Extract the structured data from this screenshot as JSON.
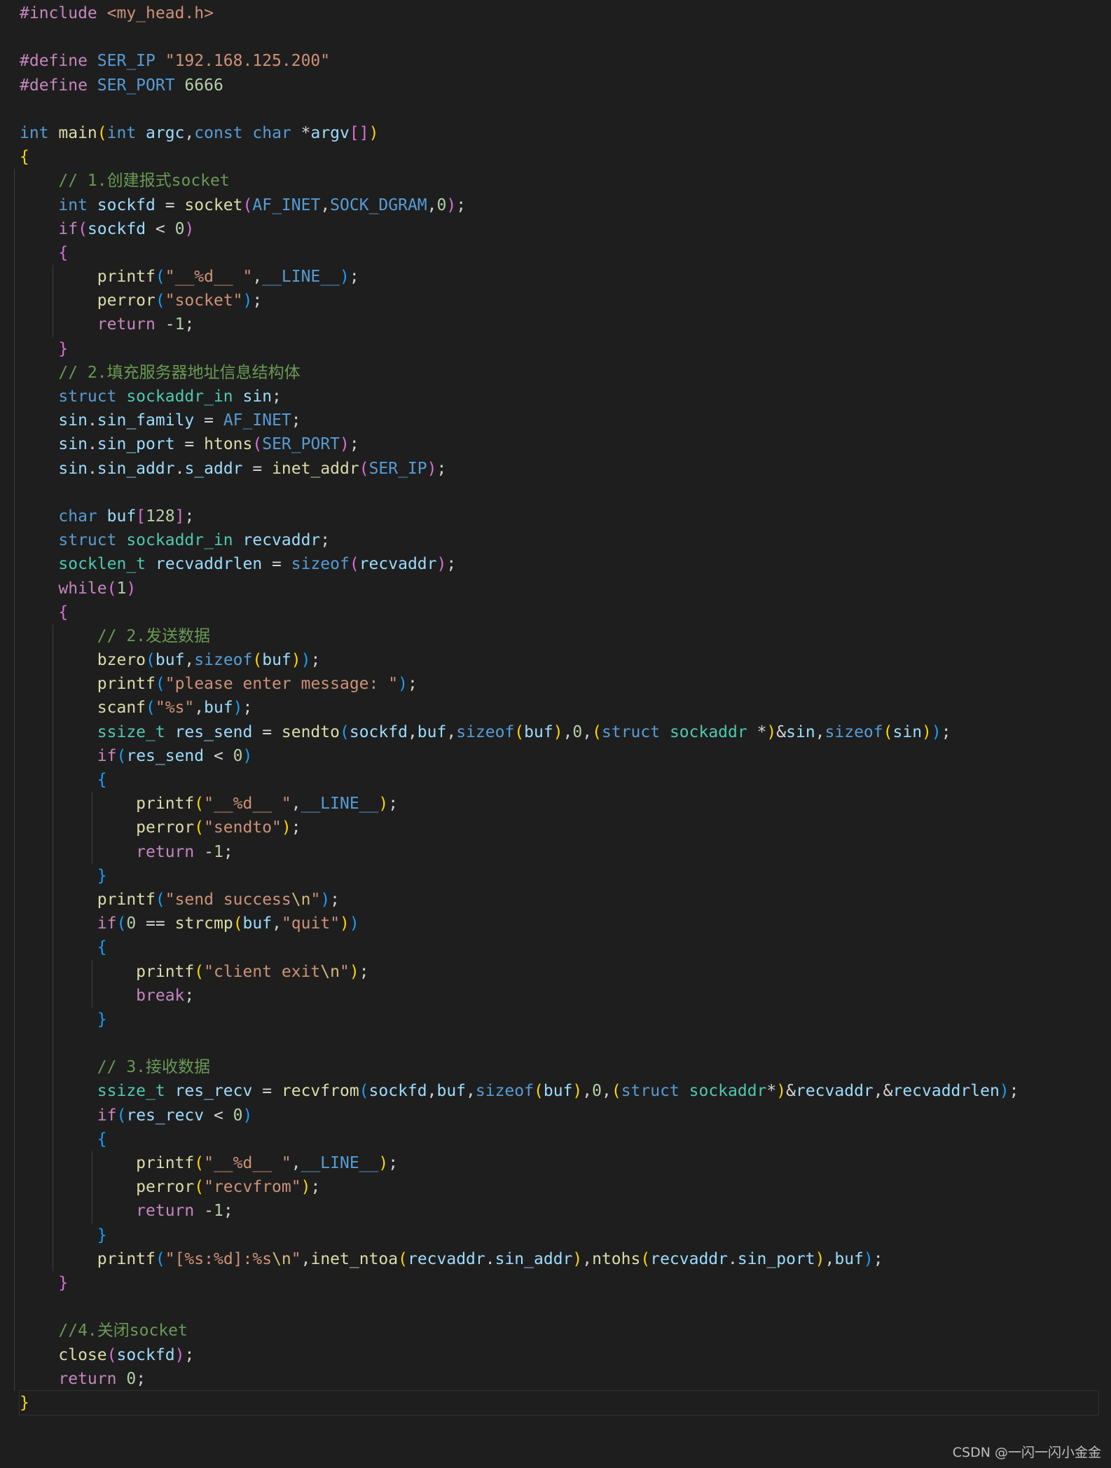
{
  "editor": {
    "theme_colors": {
      "background": "#1e1e1e",
      "keyword": "#569cd6",
      "control": "#c586c0",
      "function": "#dcdcaa",
      "variable": "#9cdcfe",
      "type": "#4ec9b0",
      "string": "#ce9178",
      "number": "#b5cea8",
      "comment": "#6a9955",
      "bracket_1": "#ffd700",
      "bracket_2": "#da70d6",
      "bracket_3": "#179fff"
    },
    "current_line": 58,
    "lines": [
      [
        [
          "pre",
          "#include "
        ],
        [
          "inc",
          "<my_head.h>"
        ]
      ],
      [],
      [
        [
          "pre",
          "#define "
        ],
        [
          "mac",
          "SER_IP "
        ],
        [
          "s",
          "\"192.168.125.200\""
        ]
      ],
      [
        [
          "pre",
          "#define "
        ],
        [
          "mac",
          "SER_PORT "
        ],
        [
          "n",
          "6666"
        ]
      ],
      [],
      [
        [
          "k",
          "int "
        ],
        [
          "f",
          "main"
        ],
        [
          "b1",
          "("
        ],
        [
          "k",
          "int "
        ],
        [
          "v",
          "argc"
        ],
        [
          "p",
          ","
        ],
        [
          "k",
          "const "
        ],
        [
          "k",
          "char "
        ],
        [
          "p",
          "*"
        ],
        [
          "v",
          "argv"
        ],
        [
          "b2",
          "[]"
        ],
        [
          "b1",
          ")"
        ]
      ],
      [
        [
          "b1",
          "{"
        ]
      ],
      [
        [
          "m",
          "    // 1.创建报式socket"
        ]
      ],
      [
        [
          "k",
          "    int "
        ],
        [
          "v",
          "sockfd"
        ],
        [
          "p",
          " = "
        ],
        [
          "f",
          "socket"
        ],
        [
          "b2",
          "("
        ],
        [
          "mac",
          "AF_INET"
        ],
        [
          "p",
          ","
        ],
        [
          "mac",
          "SOCK_DGRAM"
        ],
        [
          "p",
          ","
        ],
        [
          "n",
          "0"
        ],
        [
          "b2",
          ")"
        ],
        [
          "p",
          ";"
        ]
      ],
      [
        [
          "c",
          "    if"
        ],
        [
          "b2",
          "("
        ],
        [
          "v",
          "sockfd"
        ],
        [
          "p",
          " < "
        ],
        [
          "n",
          "0"
        ],
        [
          "b2",
          ")"
        ]
      ],
      [
        [
          "b2",
          "    {"
        ]
      ],
      [
        [
          "f",
          "        printf"
        ],
        [
          "b3",
          "("
        ],
        [
          "s",
          "\"__%d__ \""
        ],
        [
          "p",
          ","
        ],
        [
          "mac",
          "__LINE__"
        ],
        [
          "b3",
          ")"
        ],
        [
          "p",
          ";"
        ]
      ],
      [
        [
          "f",
          "        perror"
        ],
        [
          "b3",
          "("
        ],
        [
          "s",
          "\"socket\""
        ],
        [
          "b3",
          ")"
        ],
        [
          "p",
          ";"
        ]
      ],
      [
        [
          "c",
          "        return "
        ],
        [
          "p",
          "-"
        ],
        [
          "n",
          "1"
        ],
        [
          "p",
          ";"
        ]
      ],
      [
        [
          "b2",
          "    }"
        ]
      ],
      [
        [
          "m",
          "    // 2.填充服务器地址信息结构体"
        ]
      ],
      [
        [
          "k",
          "    struct "
        ],
        [
          "t",
          "sockaddr_in "
        ],
        [
          "v",
          "sin"
        ],
        [
          "p",
          ";"
        ]
      ],
      [
        [
          "v",
          "    sin"
        ],
        [
          "p",
          "."
        ],
        [
          "v",
          "sin_family"
        ],
        [
          "p",
          " = "
        ],
        [
          "mac",
          "AF_INET"
        ],
        [
          "p",
          ";"
        ]
      ],
      [
        [
          "v",
          "    sin"
        ],
        [
          "p",
          "."
        ],
        [
          "v",
          "sin_port"
        ],
        [
          "p",
          " = "
        ],
        [
          "f",
          "htons"
        ],
        [
          "b2",
          "("
        ],
        [
          "mac",
          "SER_PORT"
        ],
        [
          "b2",
          ")"
        ],
        [
          "p",
          ";"
        ]
      ],
      [
        [
          "v",
          "    sin"
        ],
        [
          "p",
          "."
        ],
        [
          "v",
          "sin_addr"
        ],
        [
          "p",
          "."
        ],
        [
          "v",
          "s_addr"
        ],
        [
          "p",
          " = "
        ],
        [
          "f",
          "inet_addr"
        ],
        [
          "b2",
          "("
        ],
        [
          "mac",
          "SER_IP"
        ],
        [
          "b2",
          ")"
        ],
        [
          "p",
          ";"
        ]
      ],
      [],
      [
        [
          "k",
          "    char "
        ],
        [
          "v",
          "buf"
        ],
        [
          "b2",
          "["
        ],
        [
          "n",
          "128"
        ],
        [
          "b2",
          "]"
        ],
        [
          "p",
          ";"
        ]
      ],
      [
        [
          "k",
          "    struct "
        ],
        [
          "t",
          "sockaddr_in "
        ],
        [
          "v",
          "recvaddr"
        ],
        [
          "p",
          ";"
        ]
      ],
      [
        [
          "t",
          "    socklen_t "
        ],
        [
          "v",
          "recvaddrlen"
        ],
        [
          "p",
          " = "
        ],
        [
          "k",
          "sizeof"
        ],
        [
          "b2",
          "("
        ],
        [
          "v",
          "recvaddr"
        ],
        [
          "b2",
          ")"
        ],
        [
          "p",
          ";"
        ]
      ],
      [
        [
          "c",
          "    while"
        ],
        [
          "b2",
          "("
        ],
        [
          "n",
          "1"
        ],
        [
          "b2",
          ")"
        ]
      ],
      [
        [
          "b2",
          "    {"
        ]
      ],
      [
        [
          "m",
          "        // 2.发送数据"
        ]
      ],
      [
        [
          "f",
          "        bzero"
        ],
        [
          "b3",
          "("
        ],
        [
          "v",
          "buf"
        ],
        [
          "p",
          ","
        ],
        [
          "k",
          "sizeof"
        ],
        [
          "b1",
          "("
        ],
        [
          "v",
          "buf"
        ],
        [
          "b1",
          ")"
        ],
        [
          "b3",
          ")"
        ],
        [
          "p",
          ";"
        ]
      ],
      [
        [
          "f",
          "        printf"
        ],
        [
          "b3",
          "("
        ],
        [
          "s",
          "\"please enter message: \""
        ],
        [
          "b3",
          ")"
        ],
        [
          "p",
          ";"
        ]
      ],
      [
        [
          "f",
          "        scanf"
        ],
        [
          "b3",
          "("
        ],
        [
          "s",
          "\"%s\""
        ],
        [
          "p",
          ","
        ],
        [
          "v",
          "buf"
        ],
        [
          "b3",
          ")"
        ],
        [
          "p",
          ";"
        ]
      ],
      [
        [
          "t",
          "        ssize_t "
        ],
        [
          "v",
          "res_send"
        ],
        [
          "p",
          " = "
        ],
        [
          "f",
          "sendto"
        ],
        [
          "b3",
          "("
        ],
        [
          "v",
          "sockfd"
        ],
        [
          "p",
          ","
        ],
        [
          "v",
          "buf"
        ],
        [
          "p",
          ","
        ],
        [
          "k",
          "sizeof"
        ],
        [
          "b1",
          "("
        ],
        [
          "v",
          "buf"
        ],
        [
          "b1",
          ")"
        ],
        [
          "p",
          ","
        ],
        [
          "n",
          "0"
        ],
        [
          "p",
          ","
        ],
        [
          "b1",
          "("
        ],
        [
          "k",
          "struct "
        ],
        [
          "t",
          "sockaddr "
        ],
        [
          "p",
          "*"
        ],
        [
          "b1",
          ")"
        ],
        [
          "p",
          "&"
        ],
        [
          "v",
          "sin"
        ],
        [
          "p",
          ","
        ],
        [
          "k",
          "sizeof"
        ],
        [
          "b1",
          "("
        ],
        [
          "v",
          "sin"
        ],
        [
          "b1",
          ")"
        ],
        [
          "b3",
          ")"
        ],
        [
          "p",
          ";"
        ]
      ],
      [
        [
          "c",
          "        if"
        ],
        [
          "b3",
          "("
        ],
        [
          "v",
          "res_send"
        ],
        [
          "p",
          " < "
        ],
        [
          "n",
          "0"
        ],
        [
          "b3",
          ")"
        ]
      ],
      [
        [
          "b3",
          "        {"
        ]
      ],
      [
        [
          "f",
          "            printf"
        ],
        [
          "b1",
          "("
        ],
        [
          "s",
          "\"__%d__ \""
        ],
        [
          "p",
          ","
        ],
        [
          "mac",
          "__LINE__"
        ],
        [
          "b1",
          ")"
        ],
        [
          "p",
          ";"
        ]
      ],
      [
        [
          "f",
          "            perror"
        ],
        [
          "b1",
          "("
        ],
        [
          "s",
          "\"sendto\""
        ],
        [
          "b1",
          ")"
        ],
        [
          "p",
          ";"
        ]
      ],
      [
        [
          "c",
          "            return "
        ],
        [
          "p",
          "-"
        ],
        [
          "n",
          "1"
        ],
        [
          "p",
          ";"
        ]
      ],
      [
        [
          "b3",
          "        }"
        ]
      ],
      [
        [
          "f",
          "        printf"
        ],
        [
          "b3",
          "("
        ],
        [
          "s",
          "\"send success"
        ],
        [
          "e",
          "\\n"
        ],
        [
          "s",
          "\""
        ],
        [
          "b3",
          ")"
        ],
        [
          "p",
          ";"
        ]
      ],
      [
        [
          "c",
          "        if"
        ],
        [
          "b3",
          "("
        ],
        [
          "n",
          "0"
        ],
        [
          "p",
          " == "
        ],
        [
          "f",
          "strcmp"
        ],
        [
          "b1",
          "("
        ],
        [
          "v",
          "buf"
        ],
        [
          "p",
          ","
        ],
        [
          "s",
          "\"quit\""
        ],
        [
          "b1",
          ")"
        ],
        [
          "b3",
          ")"
        ]
      ],
      [
        [
          "b3",
          "        {"
        ]
      ],
      [
        [
          "f",
          "            printf"
        ],
        [
          "b1",
          "("
        ],
        [
          "s",
          "\"client exit"
        ],
        [
          "e",
          "\\n"
        ],
        [
          "s",
          "\""
        ],
        [
          "b1",
          ")"
        ],
        [
          "p",
          ";"
        ]
      ],
      [
        [
          "c",
          "            break"
        ],
        [
          "p",
          ";"
        ]
      ],
      [
        [
          "b3",
          "        }"
        ]
      ],
      [],
      [
        [
          "m",
          "        // 3.接收数据"
        ]
      ],
      [
        [
          "t",
          "        ssize_t "
        ],
        [
          "v",
          "res_recv"
        ],
        [
          "p",
          " = "
        ],
        [
          "f",
          "recvfrom"
        ],
        [
          "b3",
          "("
        ],
        [
          "v",
          "sockfd"
        ],
        [
          "p",
          ","
        ],
        [
          "v",
          "buf"
        ],
        [
          "p",
          ","
        ],
        [
          "k",
          "sizeof"
        ],
        [
          "b1",
          "("
        ],
        [
          "v",
          "buf"
        ],
        [
          "b1",
          ")"
        ],
        [
          "p",
          ","
        ],
        [
          "n",
          "0"
        ],
        [
          "p",
          ","
        ],
        [
          "b1",
          "("
        ],
        [
          "k",
          "struct "
        ],
        [
          "t",
          "sockaddr"
        ],
        [
          "p",
          "*"
        ],
        [
          "b1",
          ")"
        ],
        [
          "p",
          "&"
        ],
        [
          "v",
          "recvaddr"
        ],
        [
          "p",
          ",&"
        ],
        [
          "v",
          "recvaddrlen"
        ],
        [
          "b3",
          ")"
        ],
        [
          "p",
          ";"
        ]
      ],
      [
        [
          "c",
          "        if"
        ],
        [
          "b3",
          "("
        ],
        [
          "v",
          "res_recv"
        ],
        [
          "p",
          " < "
        ],
        [
          "n",
          "0"
        ],
        [
          "b3",
          ")"
        ]
      ],
      [
        [
          "b3",
          "        {"
        ]
      ],
      [
        [
          "f",
          "            printf"
        ],
        [
          "b1",
          "("
        ],
        [
          "s",
          "\"__%d__ \""
        ],
        [
          "p",
          ","
        ],
        [
          "mac",
          "__LINE__"
        ],
        [
          "b1",
          ")"
        ],
        [
          "p",
          ";"
        ]
      ],
      [
        [
          "f",
          "            perror"
        ],
        [
          "b1",
          "("
        ],
        [
          "s",
          "\"recvfrom\""
        ],
        [
          "b1",
          ")"
        ],
        [
          "p",
          ";"
        ]
      ],
      [
        [
          "c",
          "            return "
        ],
        [
          "p",
          "-"
        ],
        [
          "n",
          "1"
        ],
        [
          "p",
          ";"
        ]
      ],
      [
        [
          "b3",
          "        }"
        ]
      ],
      [
        [
          "f",
          "        printf"
        ],
        [
          "b3",
          "("
        ],
        [
          "s",
          "\"[%s:%d]:%s"
        ],
        [
          "e",
          "\\n"
        ],
        [
          "s",
          "\""
        ],
        [
          "p",
          ","
        ],
        [
          "f",
          "inet_ntoa"
        ],
        [
          "b1",
          "("
        ],
        [
          "v",
          "recvaddr"
        ],
        [
          "p",
          "."
        ],
        [
          "v",
          "sin_addr"
        ],
        [
          "b1",
          ")"
        ],
        [
          "p",
          ","
        ],
        [
          "f",
          "ntohs"
        ],
        [
          "b1",
          "("
        ],
        [
          "v",
          "recvaddr"
        ],
        [
          "p",
          "."
        ],
        [
          "v",
          "sin_port"
        ],
        [
          "b1",
          ")"
        ],
        [
          "p",
          ","
        ],
        [
          "v",
          "buf"
        ],
        [
          "b3",
          ")"
        ],
        [
          "p",
          ";"
        ]
      ],
      [
        [
          "b2",
          "    }"
        ]
      ],
      [],
      [
        [
          "m",
          "    //4.关闭socket"
        ]
      ],
      [
        [
          "f",
          "    close"
        ],
        [
          "b2",
          "("
        ],
        [
          "v",
          "sockfd"
        ],
        [
          "b2",
          ")"
        ],
        [
          "p",
          ";"
        ]
      ],
      [
        [
          "c",
          "    return "
        ],
        [
          "n",
          "0"
        ],
        [
          "p",
          ";"
        ]
      ],
      [
        [
          "b1",
          "}"
        ]
      ]
    ]
  },
  "watermark": {
    "text": "CSDN @一闪一闪小金金"
  }
}
